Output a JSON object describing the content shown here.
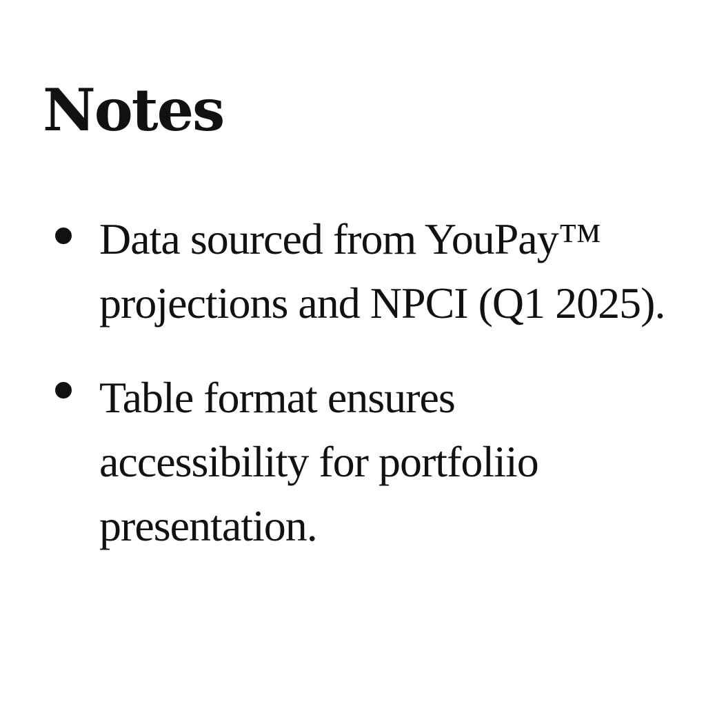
{
  "heading": "Notes",
  "notes": [
    {
      "lines": [
        "Data sourced from YouPay™",
        "projections and NPCI (Q1 2025)."
      ]
    },
    {
      "lines": [
        "Table format ensures",
        "accessibility for portfoliio",
        "presentation."
      ]
    }
  ],
  "colors": {
    "text": "#111111",
    "background": "#ffffff"
  }
}
